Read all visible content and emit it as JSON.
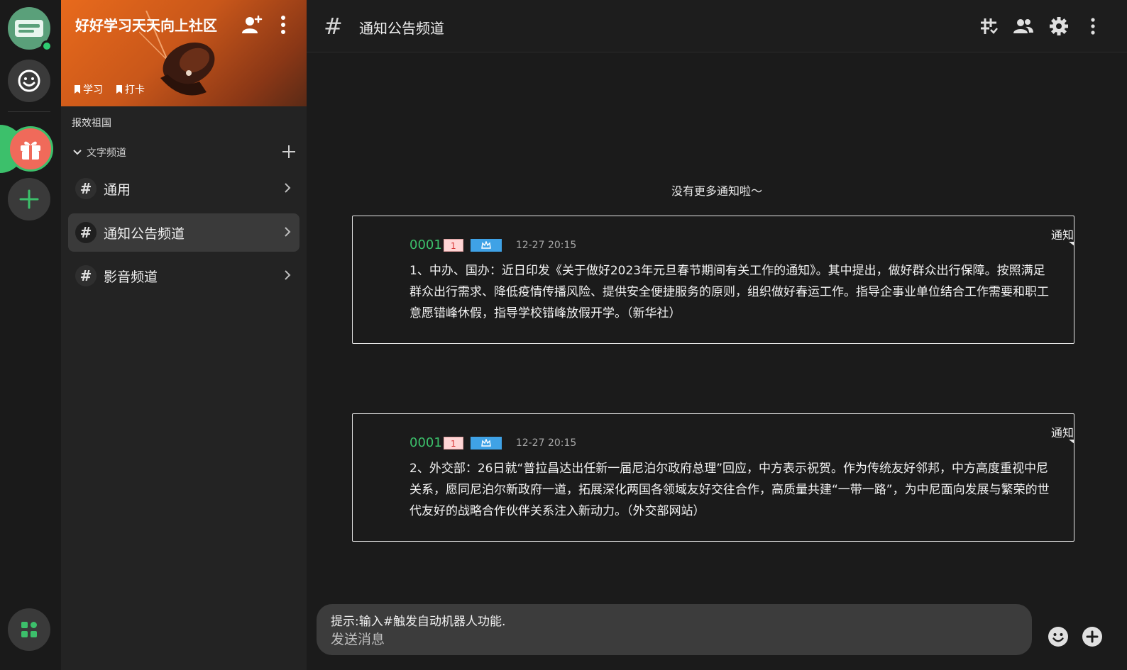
{
  "rail": {
    "servers": [
      {
        "name": "server-list-icon",
        "bg": "#5aa07a"
      },
      {
        "name": "smiley-icon",
        "bg": "#3a3a3a"
      },
      {
        "name": "gift-icon",
        "bg": "#f07060",
        "active": true
      },
      {
        "name": "add-icon",
        "bg": "#3a3a3a"
      }
    ],
    "bottom_icon": "apps-icon",
    "accent": "#3cc06b"
  },
  "sidebar": {
    "guild_name": "好好学习天天向上社区",
    "tags": [
      "学习",
      "打卡"
    ],
    "section_label": "报效祖国",
    "category_label": "文字频道",
    "channels": [
      {
        "hash": "#",
        "name": "通用"
      },
      {
        "hash": "#",
        "name": "通知公告频道",
        "active": true
      },
      {
        "hash": "#",
        "name": "影音频道"
      }
    ]
  },
  "header": {
    "hash": "#",
    "title": "通知公告频道",
    "icons": [
      "channel-grid-icon",
      "members-icon",
      "settings-icon",
      "more-vertical-icon"
    ]
  },
  "feed": {
    "no_more": "没有更多通知啦～",
    "notices": [
      {
        "label": "通知",
        "author": "0001",
        "badge_number": "1",
        "time": "12-27 20:15",
        "content": "1、中办、国办：近日印发《关于做好2023年元旦春节期间有关工作的通知》。其中提出，做好群众出行保障。按照满足群众出行需求、降低疫情传播风险、提供安全便捷服务的原则，组织做好春运工作。指导企事业单位结合工作需要和职工意愿错峰休假，指导学校错峰放假开学。（新华社）"
      },
      {
        "label": "通知",
        "author": "0001",
        "badge_number": "1",
        "time": "12-27 20:15",
        "content": "2、外交部：26日就“普拉昌达出任新一届尼泊尔政府总理”回应，中方表示祝贺。作为传统友好邻邦，中方高度重视中尼关系，愿同尼泊尔新政府一道，拓展深化两国各领域友好交往合作，高质量共建“一带一路”，为中尼面向发展与繁荣的世代友好的战略合作伙伴关系注入新动力。（外交部网站）"
      }
    ]
  },
  "composer": {
    "hint": "提示:输入#触发自动机器人功能.",
    "placeholder": "发送消息"
  }
}
